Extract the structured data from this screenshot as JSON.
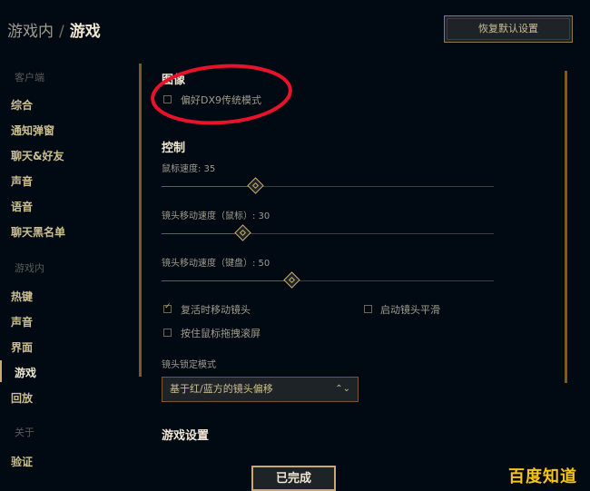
{
  "breadcrumb": {
    "parent": "游戏内",
    "separator": "/",
    "current": "游戏"
  },
  "reset_button": "恢复默认设置",
  "sidebar": {
    "client_section": "客户端",
    "client_items": [
      "综合",
      "通知弹窗",
      "聊天&好友",
      "声音",
      "语音",
      "聊天黑名单"
    ],
    "ingame_section": "游戏内",
    "ingame_items": [
      "热键",
      "声音",
      "界面",
      "游戏",
      "回放"
    ],
    "about_section": "关于",
    "about_items": [
      "验证"
    ],
    "active": "游戏"
  },
  "graphics": {
    "heading": "图像",
    "prefer_dx9": {
      "label": "偏好DX9传统模式",
      "checked": false
    }
  },
  "controls": {
    "heading": "控制",
    "mouse_speed": {
      "label": "鼠标速度: 35",
      "value": 35
    },
    "camera_speed_mouse": {
      "label": "镜头移动速度（鼠标）: 30",
      "value": 30
    },
    "camera_speed_keyboard": {
      "label": "镜头移动速度（键盘）: 50",
      "value": 50
    },
    "camera_move_on_revive": {
      "label": "复活时移动镜头",
      "checked": true
    },
    "smooth_camera": {
      "label": "启动镜头平滑",
      "checked": false
    },
    "hold_drag_scroll": {
      "label": "按住鼠标拖拽滚屏",
      "checked": false
    },
    "camera_lock_label": "镜头锁定模式",
    "camera_lock_value": "基于红/蓝方的镜头偏移"
  },
  "game_settings_heading": "游戏设置",
  "done_button": "已完成",
  "watermark": "百度知道",
  "colors": {
    "gold": "#c8aa6e",
    "background": "#010a13",
    "annotation": "#e8132a"
  }
}
